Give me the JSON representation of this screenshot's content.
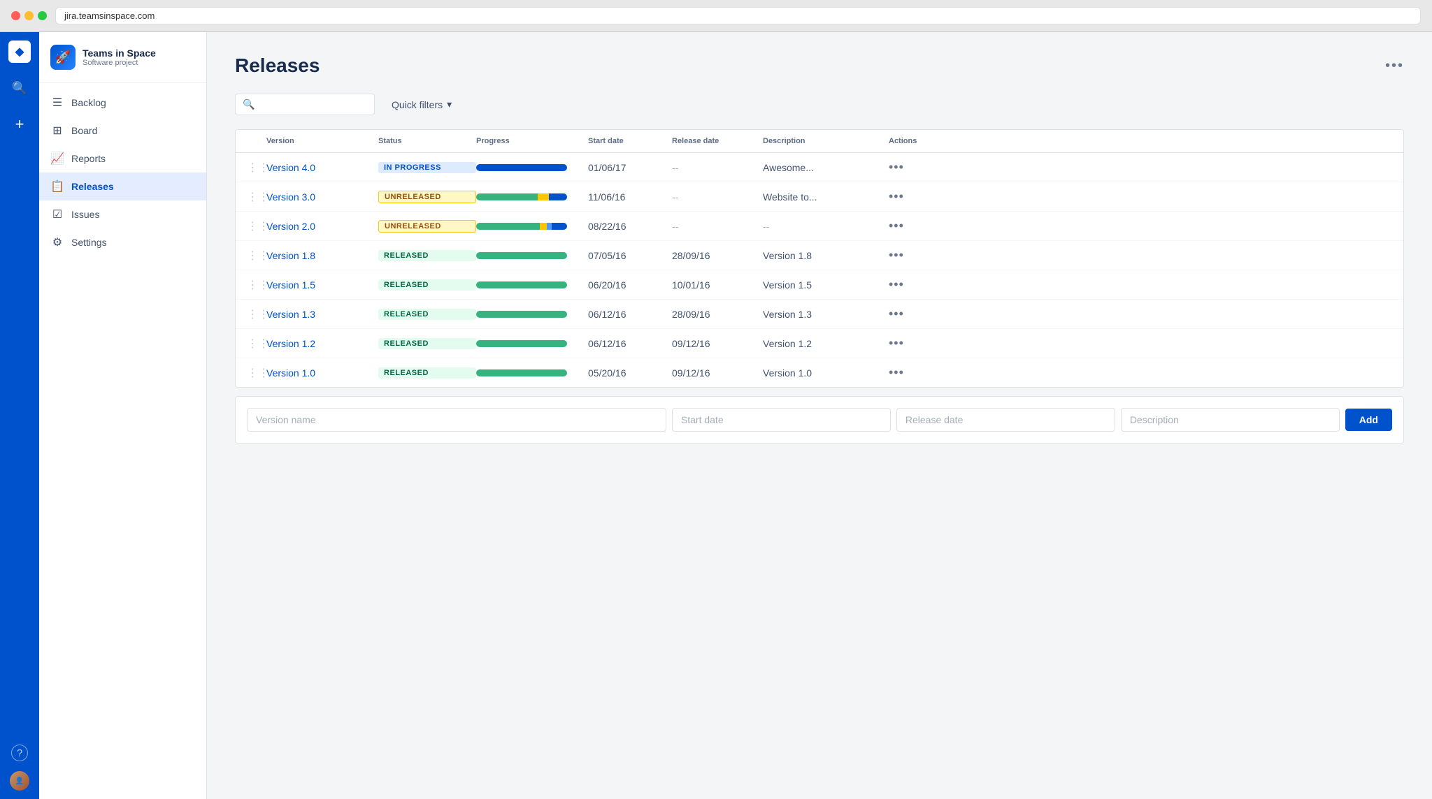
{
  "browser": {
    "url": "jira.teamsinspace.com"
  },
  "sidebar": {
    "project_name": "Teams in Space",
    "project_sub": "Software project",
    "project_icon": "🚀",
    "nav_items": [
      {
        "id": "backlog",
        "label": "Backlog",
        "icon": "☰",
        "active": false
      },
      {
        "id": "board",
        "label": "Board",
        "icon": "⊞",
        "active": false
      },
      {
        "id": "reports",
        "label": "Reports",
        "icon": "📈",
        "active": false
      },
      {
        "id": "releases",
        "label": "Releases",
        "icon": "📋",
        "active": true
      },
      {
        "id": "issues",
        "label": "Issues",
        "icon": "☑",
        "active": false
      },
      {
        "id": "settings",
        "label": "Settings",
        "icon": "⚙",
        "active": false
      }
    ]
  },
  "page": {
    "title": "Releases",
    "more_actions_label": "•••"
  },
  "filters": {
    "search_placeholder": "",
    "quick_filters_label": "Quick filters"
  },
  "table": {
    "columns": [
      "",
      "Version",
      "Status",
      "Progress",
      "Start date",
      "Release date",
      "Description",
      "Actions"
    ],
    "rows": [
      {
        "version": "Version 4.0",
        "status": "IN PROGRESS",
        "status_type": "in-progress",
        "progress": [
          {
            "color": "blue",
            "pct": 100
          }
        ],
        "start_date": "01/06/17",
        "release_date": "--",
        "description": "Awesome...",
        "actions": "•••"
      },
      {
        "version": "Version 3.0",
        "status": "UNRELEASED",
        "status_type": "unreleased",
        "progress": [
          {
            "color": "green",
            "pct": 68
          },
          {
            "color": "yellow",
            "pct": 12
          },
          {
            "color": "blue",
            "pct": 20
          }
        ],
        "start_date": "11/06/16",
        "release_date": "--",
        "description": "Website to...",
        "actions": "•••"
      },
      {
        "version": "Version 2.0",
        "status": "UNRELEASED",
        "status_type": "unreleased",
        "progress": [
          {
            "color": "green",
            "pct": 70
          },
          {
            "color": "yellow",
            "pct": 8
          },
          {
            "color": "light-blue",
            "pct": 5
          },
          {
            "color": "blue",
            "pct": 17
          }
        ],
        "start_date": "08/22/16",
        "release_date": "--",
        "description": "--",
        "actions": "•••"
      },
      {
        "version": "Version 1.8",
        "status": "RELEASED",
        "status_type": "released",
        "progress": [
          {
            "color": "green",
            "pct": 100
          }
        ],
        "start_date": "07/05/16",
        "release_date": "28/09/16",
        "description": "Version 1.8",
        "actions": "•••"
      },
      {
        "version": "Version 1.5",
        "status": "RELEASED",
        "status_type": "released",
        "progress": [
          {
            "color": "green",
            "pct": 100
          }
        ],
        "start_date": "06/20/16",
        "release_date": "10/01/16",
        "description": "Version 1.5",
        "actions": "•••"
      },
      {
        "version": "Version 1.3",
        "status": "RELEASED",
        "status_type": "released",
        "progress": [
          {
            "color": "green",
            "pct": 100
          }
        ],
        "start_date": "06/12/16",
        "release_date": "28/09/16",
        "description": "Version 1.3",
        "actions": "•••"
      },
      {
        "version": "Version 1.2",
        "status": "RELEASED",
        "status_type": "released",
        "progress": [
          {
            "color": "green",
            "pct": 100
          }
        ],
        "start_date": "06/12/16",
        "release_date": "09/12/16",
        "description": "Version 1.2",
        "actions": "•••"
      },
      {
        "version": "Version 1.0",
        "status": "RELEASED",
        "status_type": "released",
        "progress": [
          {
            "color": "green",
            "pct": 100
          }
        ],
        "start_date": "05/20/16",
        "release_date": "09/12/16",
        "description": "Version 1.0",
        "actions": "•••"
      }
    ]
  },
  "add_row": {
    "version_placeholder": "Version name",
    "start_date_placeholder": "Start date",
    "release_date_placeholder": "Release date",
    "description_placeholder": "Description",
    "add_button_label": "Add"
  }
}
